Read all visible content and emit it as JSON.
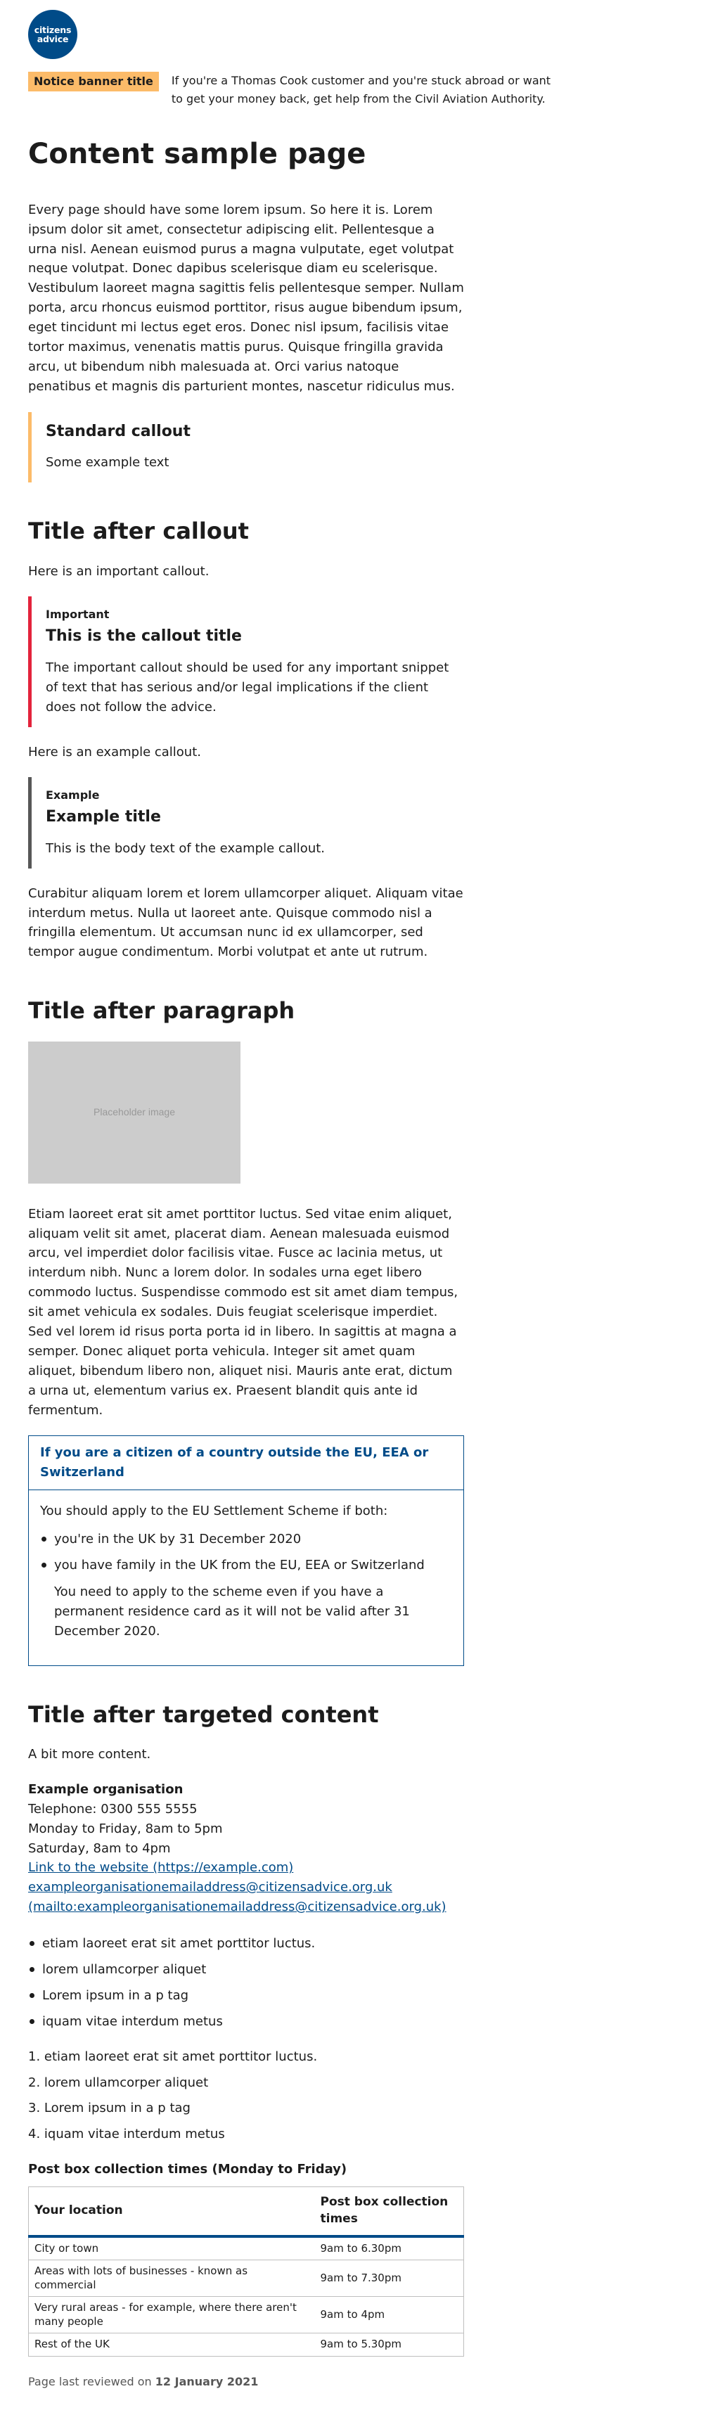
{
  "logo": {
    "line1": "citizens",
    "line2": "advice"
  },
  "notice": {
    "title": "Notice banner title",
    "text": "If you're a Thomas Cook customer and you're stuck abroad or want to get your money back, get help from the Civil Aviation Authority."
  },
  "page_title": "Content sample page",
  "intro": "Every page should have some lorem ipsum. So here it is. Lorem ipsum dolor sit amet, consectetur adipiscing elit. Pellentesque a urna nisl. Aenean euismod purus a magna vulputate, eget volutpat neque volutpat. Donec dapibus scelerisque diam eu scelerisque. Vestibulum laoreet magna sagittis felis pellentesque semper. Nullam porta, arcu rhoncus euismod porttitor, risus augue bibendum ipsum, eget tincidunt mi lectus eget eros. Donec nisl ipsum, facilisis vitae tortor maximus, venenatis mattis purus. Quisque fringilla gravida arcu, ut bibendum nibh malesuada at. Orci varius natoque penatibus et magnis dis parturient montes, nascetur ridiculus mus.",
  "standard_callout": {
    "title": "Standard callout",
    "text": "Some example text"
  },
  "section1": {
    "title": "Title after callout",
    "lead": "Here is an important callout.",
    "important": {
      "label": "Important",
      "title": "This is the callout title",
      "text": "The important callout should be used for any important snippet of text that has serious and/or legal implications if the client does not follow the advice."
    },
    "lead2": "Here is an example callout.",
    "example": {
      "label": "Example",
      "title": "Example title",
      "text": "This is the body text of the example callout."
    },
    "para": "Curabitur aliquam lorem et lorem ullamcorper aliquet. Aliquam vitae interdum metus. Nulla ut laoreet ante. Quisque commodo nisl a fringilla elementum. Ut accumsan nunc id ex ullamcorper, sed tempor augue condimentum. Morbi volutpat et ante ut rutrum."
  },
  "section2": {
    "title": "Title after paragraph",
    "image_label": "Placeholder image",
    "para": "Etiam laoreet erat sit amet porttitor luctus. Sed vitae enim aliquet, aliquam velit sit amet, placerat diam. Aenean malesuada euismod arcu, vel imperdiet dolor facilisis vitae. Fusce ac lacinia metus, ut interdum nibh. Nunc a lorem dolor. In sodales urna eget libero commodo luctus. Suspendisse commodo est sit amet diam tempus, sit amet vehicula ex sodales. Duis feugiat scelerisque imperdiet. Sed vel lorem id risus porta porta id in libero. In sagittis at magna a semper. Donec aliquet porta vehicula. Integer sit amet quam aliquet, bibendum libero non, aliquet nisi. Mauris ante erat, dictum a urna ut, elementum varius ex. Praesent blandit quis ante id fermentum."
  },
  "targeted": {
    "heading": "If you are a citizen of a country outside the EU, EEA or Switzerland",
    "intro": "You should apply to the EU Settlement Scheme if both:",
    "items": [
      "you're in the UK by 31 December 2020",
      "you have family in the UK from the EU, EEA or Switzerland"
    ],
    "note": "You need to apply to the scheme even if you have a permanent residence card as it will not be valid after 31 December 2020."
  },
  "section3": {
    "title": "Title after targeted content",
    "lead": "A bit more content.",
    "contact": {
      "name": "Example organisation",
      "telephone": "Telephone: 0300 555 5555",
      "hours1": "Monday to Friday, 8am to 5pm",
      "hours2": "Saturday, 8am to 4pm",
      "website_link": "Link to the website (https://example.com)",
      "email": "exampleorganisationemailaddress@citizensadvice.org.uk",
      "email_mailto": "(mailto:exampleorganisationemailaddress@citizensadvice.org.uk)"
    },
    "bullets": [
      "etiam laoreet erat sit amet porttitor luctus.",
      "lorem ullamcorper aliquet",
      "Lorem ipsum in a p tag",
      "iquam vitae interdum metus"
    ],
    "numbered": [
      "1. etiam laoreet erat sit amet porttitor luctus.",
      "2. lorem ullamcorper aliquet",
      "3. Lorem ipsum in a p tag",
      "4. iquam vitae interdum metus"
    ]
  },
  "table": {
    "caption": "Post box collection times (Monday to Friday)",
    "headers": [
      "Your location",
      "Post box collection times"
    ],
    "rows": [
      [
        "City or town",
        "9am to 6.30pm"
      ],
      [
        "Areas with lots of businesses - known as commercial",
        "9am to 7.30pm"
      ],
      [
        "Very rural areas - for example, where there aren't many people",
        "9am to 4pm"
      ],
      [
        "Rest of the UK",
        "9am to 5.30pm"
      ]
    ]
  },
  "footer": {
    "reviewed_prefix": "Page last reviewed on",
    "reviewed_date": "12 January 2021"
  },
  "colors": {
    "brand_blue": "#004b88",
    "notice_orange": "#fcbb69",
    "important_red": "#e3233c",
    "example_grey": "#575757"
  }
}
